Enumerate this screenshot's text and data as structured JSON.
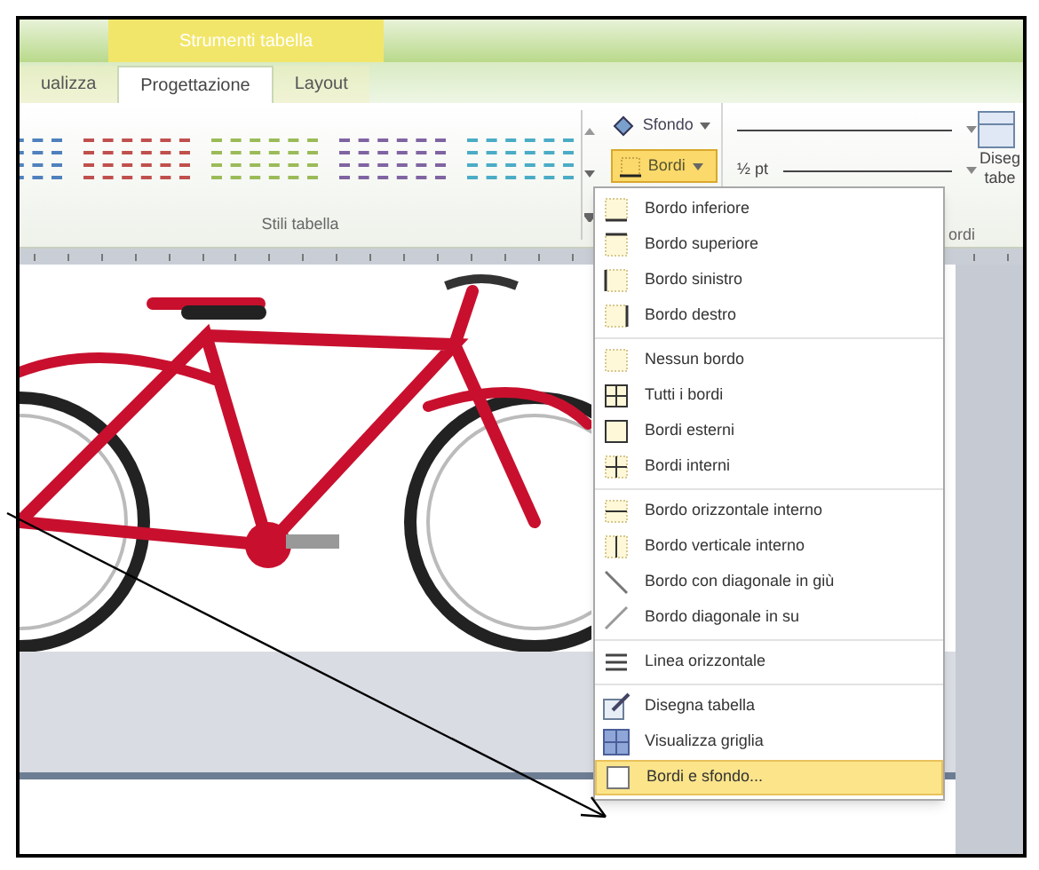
{
  "ribbon": {
    "context_title": "Strumenti tabella",
    "tabs": [
      {
        "label": "ualizza",
        "selected": false
      },
      {
        "label": "Progettazione",
        "selected": true
      },
      {
        "label": "Layout",
        "selected": false
      }
    ],
    "table_styles": [
      {
        "color": "#4f81bd"
      },
      {
        "color": "#c0504d"
      },
      {
        "color": "#9bbb59"
      },
      {
        "color": "#8064a2"
      },
      {
        "color": "#4bacc6"
      }
    ],
    "styles_group": "Stili tabella",
    "shading_button": "Sfondo",
    "borders_button": "Bordi",
    "line_weight": "½ pt",
    "draw_table_button": "Diseg tabe",
    "borders_group": "ordi"
  },
  "menu": {
    "sections": [
      [
        {
          "kind": "bottom",
          "label": "Bordo inferiore",
          "selected": false
        },
        {
          "kind": "top",
          "label": "Bordo superiore",
          "selected": false
        },
        {
          "kind": "left",
          "label": "Bordo sinistro",
          "selected": false
        },
        {
          "kind": "right",
          "label": "Bordo destro",
          "selected": false
        }
      ],
      [
        {
          "kind": "none",
          "label": "Nessun bordo",
          "selected": false
        },
        {
          "kind": "all",
          "label": "Tutti i bordi",
          "selected": false
        },
        {
          "kind": "outside",
          "label": "Bordi esterni",
          "selected": false
        },
        {
          "kind": "inside",
          "label": "Bordi interni",
          "selected": false
        }
      ],
      [
        {
          "kind": "inside_h",
          "label": "Bordo orizzontale interno",
          "selected": false
        },
        {
          "kind": "inside_v",
          "label": "Bordo verticale interno",
          "selected": false
        },
        {
          "kind": "diag_down",
          "label": "Bordo con diagonale in giù",
          "selected": false
        },
        {
          "kind": "diag_up",
          "label": "Bordo diagonale in su",
          "selected": false
        }
      ],
      [
        {
          "kind": "hline",
          "label": "Linea orizzontale",
          "selected": false
        }
      ],
      [
        {
          "kind": "draw",
          "label": "Disegna tabella",
          "selected": false
        },
        {
          "kind": "grid",
          "label": "Visualizza griglia",
          "selected": false
        },
        {
          "kind": "dialog",
          "label": "Bordi e sfondo...",
          "selected": true
        }
      ]
    ]
  }
}
